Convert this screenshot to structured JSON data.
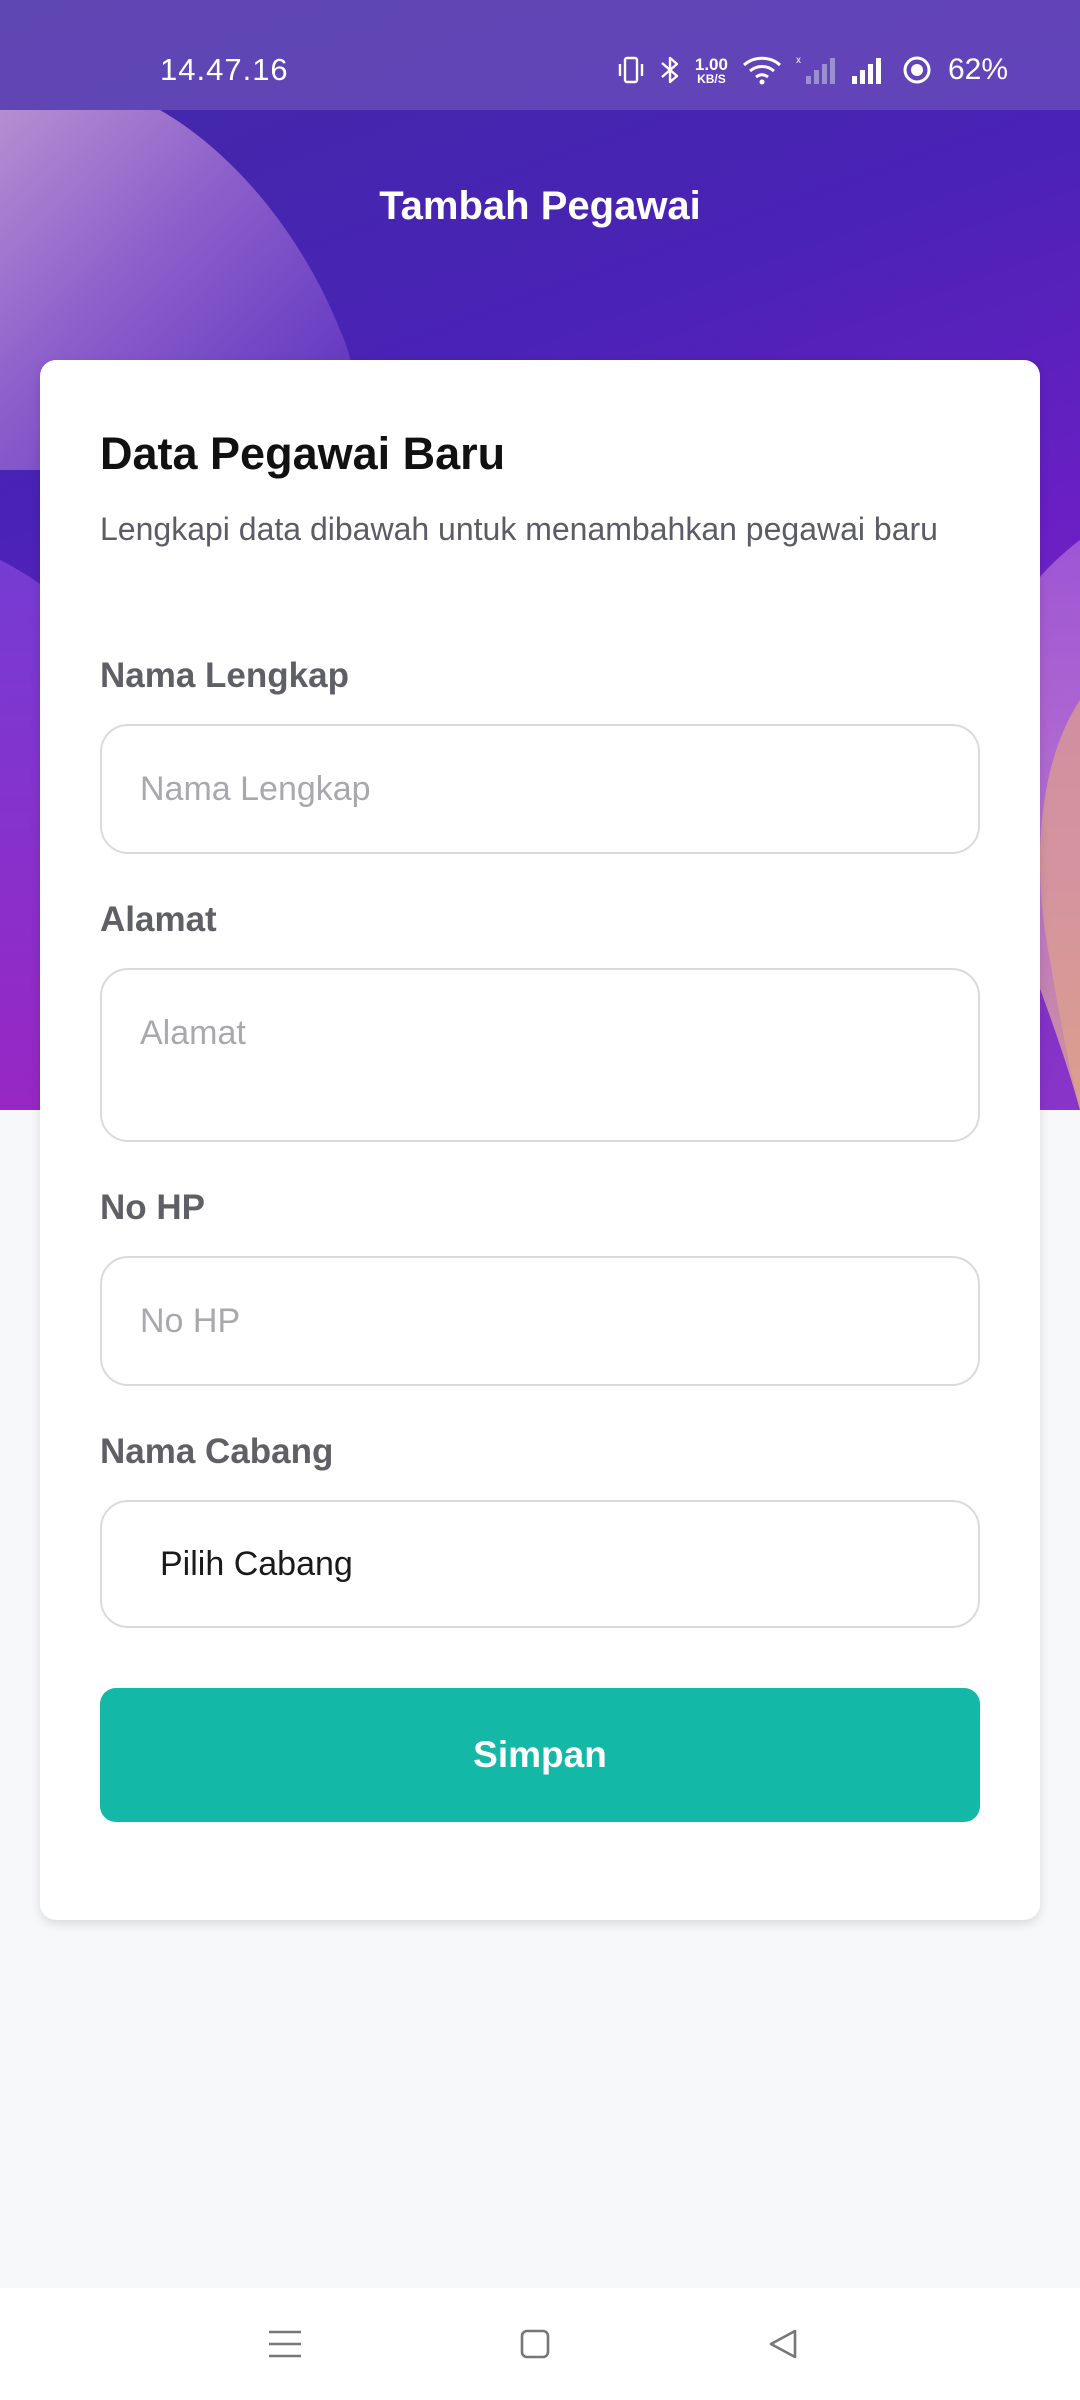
{
  "status_bar": {
    "time": "14.47.16",
    "network_speed": "1.00",
    "network_speed_unit": "KB/S",
    "battery": "62%"
  },
  "header": {
    "title": "Tambah Pegawai"
  },
  "form": {
    "title": "Data Pegawai Baru",
    "subtitle": "Lengkapi data dibawah untuk menambahkan pegawai baru",
    "fields": {
      "nama_lengkap": {
        "label": "Nama Lengkap",
        "placeholder": "Nama Lengkap",
        "value": ""
      },
      "alamat": {
        "label": "Alamat",
        "placeholder": "Alamat",
        "value": ""
      },
      "no_hp": {
        "label": "No HP",
        "placeholder": "No HP",
        "value": ""
      },
      "nama_cabang": {
        "label": "Nama Cabang",
        "selected": "Pilih Cabang"
      }
    },
    "submit_label": "Simpan"
  },
  "colors": {
    "primary": "#14b8a6",
    "hero_gradient": [
      "#3f2aa6",
      "#6a1fc4",
      "#8a35c9"
    ]
  },
  "nav_bar": {
    "icons": [
      "menu-icon",
      "home-icon",
      "back-icon"
    ]
  }
}
